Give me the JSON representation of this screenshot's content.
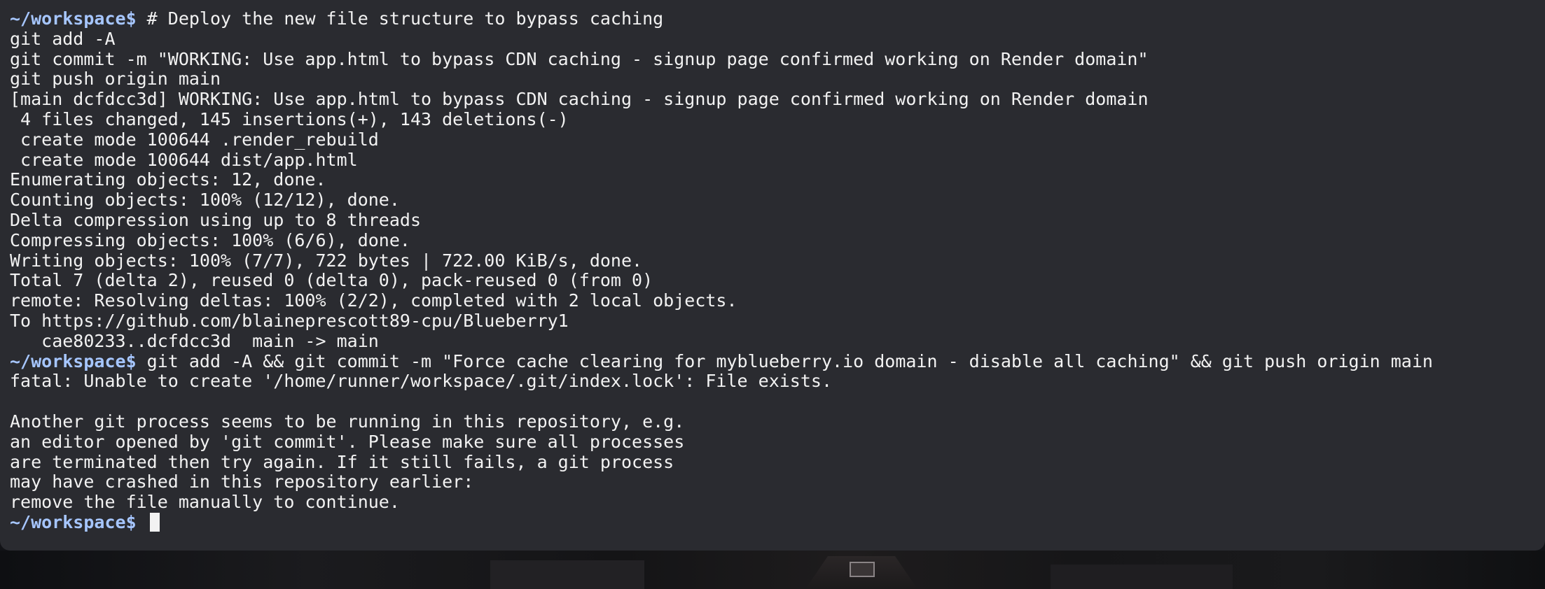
{
  "terminal": {
    "prompt": "~/workspace$",
    "lines": [
      {
        "prompt": true,
        "text": " # Deploy the new file structure to bypass caching"
      },
      {
        "prompt": false,
        "text": "git add -A"
      },
      {
        "prompt": false,
        "text": "git commit -m \"WORKING: Use app.html to bypass CDN caching - signup page confirmed working on Render domain\""
      },
      {
        "prompt": false,
        "text": "git push origin main"
      },
      {
        "prompt": false,
        "text": "[main dcfdcc3d] WORKING: Use app.html to bypass CDN caching - signup page confirmed working on Render domain"
      },
      {
        "prompt": false,
        "text": " 4 files changed, 145 insertions(+), 143 deletions(-)"
      },
      {
        "prompt": false,
        "text": " create mode 100644 .render_rebuild"
      },
      {
        "prompt": false,
        "text": " create mode 100644 dist/app.html"
      },
      {
        "prompt": false,
        "text": "Enumerating objects: 12, done."
      },
      {
        "prompt": false,
        "text": "Counting objects: 100% (12/12), done."
      },
      {
        "prompt": false,
        "text": "Delta compression using up to 8 threads"
      },
      {
        "prompt": false,
        "text": "Compressing objects: 100% (6/6), done."
      },
      {
        "prompt": false,
        "text": "Writing objects: 100% (7/7), 722 bytes | 722.00 KiB/s, done."
      },
      {
        "prompt": false,
        "text": "Total 7 (delta 2), reused 0 (delta 0), pack-reused 0 (from 0)"
      },
      {
        "prompt": false,
        "text": "remote: Resolving deltas: 100% (2/2), completed with 2 local objects."
      },
      {
        "prompt": false,
        "text": "To https://github.com/blaineprescott89-cpu/Blueberry1"
      },
      {
        "prompt": false,
        "text": "   cae80233..dcfdcc3d  main -> main"
      },
      {
        "prompt": true,
        "text": " git add -A && git commit -m \"Force cache clearing for myblueberry.io domain - disable all caching\" && git push origin main"
      },
      {
        "prompt": false,
        "text": "fatal: Unable to create '/home/runner/workspace/.git/index.lock': File exists."
      },
      {
        "prompt": false,
        "text": ""
      },
      {
        "prompt": false,
        "text": "Another git process seems to be running in this repository, e.g."
      },
      {
        "prompt": false,
        "text": "an editor opened by 'git commit'. Please make sure all processes"
      },
      {
        "prompt": false,
        "text": "are terminated then try again. If it still fails, a git process"
      },
      {
        "prompt": false,
        "text": "may have crashed in this repository earlier:"
      },
      {
        "prompt": false,
        "text": "remove the file manually to continue."
      },
      {
        "prompt": true,
        "text": " ",
        "cursor": true
      }
    ]
  },
  "colors": {
    "background": "#2a2b30",
    "text": "#f2f2f2",
    "prompt": "#a6c6ff"
  }
}
